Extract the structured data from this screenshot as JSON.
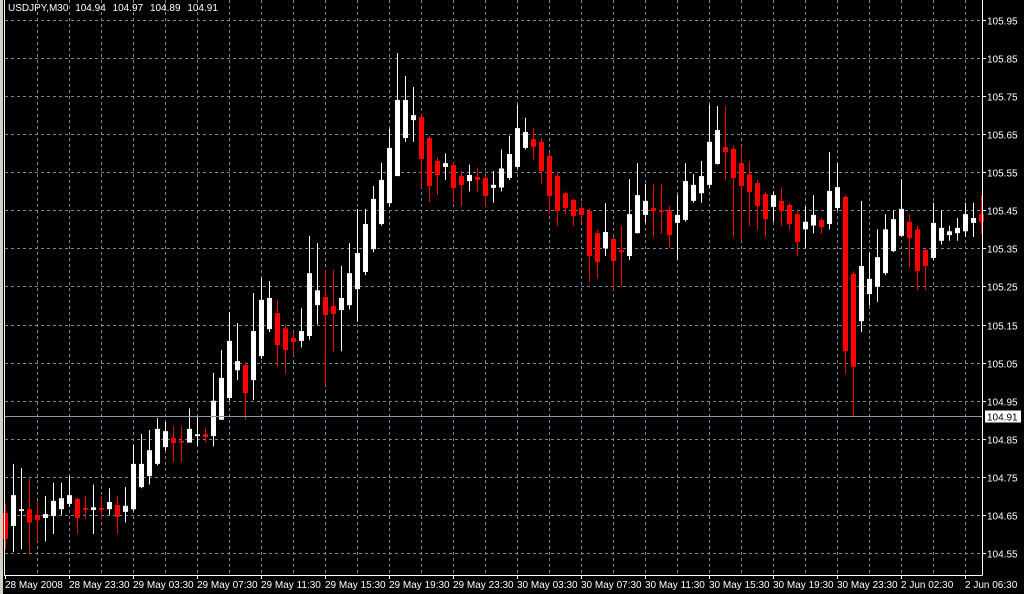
{
  "header": {
    "symbol": "USDJPY,M30",
    "open": "104.94",
    "high": "104.97",
    "low": "104.89",
    "close": "104.91"
  },
  "colors": {
    "background": "#000000",
    "bull": "#ffffff",
    "bear": "#ff0000",
    "grid": "#778899",
    "axis": "#ffffff",
    "price_line": "#8c9aa8"
  },
  "chart_data": {
    "type": "candlestick",
    "title": "USDJPY,M30",
    "ylim": [
      104.52,
      106.0
    ],
    "grid": true,
    "y_ticks": [
      "105.95",
      "105.85",
      "105.75",
      "105.65",
      "105.55",
      "105.45",
      "105.35",
      "105.25",
      "105.15",
      "105.05",
      "104.95",
      "104.85",
      "104.75",
      "104.65",
      "104.55"
    ],
    "x_ticks": [
      "28 May 2008",
      "28 May 23:30",
      "29 May 03:30",
      "29 May 07:30",
      "29 May 11:30",
      "29 May 15:30",
      "29 May 19:30",
      "29 May 23:30",
      "30 May 03:30",
      "30 May 07:30",
      "30 May 11:30",
      "30 May 15:30",
      "30 May 19:30",
      "30 May 23:30",
      "2 Jun 02:30",
      "2 Jun 06:30"
    ],
    "bars_per_x_tick": 8,
    "current_price": "104.91",
    "ohlc": [
      [
        104.655,
        104.68,
        104.56,
        104.587
      ],
      [
        104.621,
        104.784,
        104.553,
        104.702
      ],
      [
        104.66,
        104.773,
        104.56,
        104.665
      ],
      [
        104.665,
        104.745,
        104.55,
        104.63
      ],
      [
        104.65,
        104.684,
        104.58,
        104.637
      ],
      [
        104.642,
        104.7,
        104.58,
        104.652
      ],
      [
        104.647,
        104.734,
        104.6,
        104.687
      ],
      [
        104.665,
        104.734,
        104.65,
        104.694
      ],
      [
        104.679,
        104.752,
        104.671,
        104.702
      ],
      [
        104.692,
        104.695,
        104.6,
        104.642
      ],
      [
        104.668,
        104.7,
        104.64,
        104.663
      ],
      [
        104.663,
        104.73,
        104.6,
        104.67
      ],
      [
        104.668,
        104.7,
        104.64,
        104.663
      ],
      [
        104.665,
        104.72,
        104.65,
        104.684
      ],
      [
        104.676,
        104.7,
        104.6,
        104.645
      ],
      [
        104.658,
        104.723,
        104.63,
        104.674
      ],
      [
        104.665,
        104.834,
        104.66,
        104.784
      ],
      [
        104.723,
        104.863,
        104.72,
        104.784
      ],
      [
        104.752,
        104.873,
        104.73,
        104.82
      ],
      [
        104.784,
        104.904,
        104.78,
        104.876
      ],
      [
        104.828,
        104.894,
        104.82,
        104.87
      ],
      [
        104.852,
        104.883,
        104.79,
        104.839
      ],
      [
        104.845,
        104.883,
        104.79,
        104.84
      ],
      [
        104.84,
        104.93,
        104.84,
        104.876
      ],
      [
        104.857,
        104.907,
        104.83,
        104.862
      ],
      [
        104.862,
        104.88,
        104.84,
        104.855
      ],
      [
        104.857,
        105.023,
        104.83,
        104.95
      ],
      [
        104.9,
        105.083,
        104.9,
        105.01
      ],
      [
        104.957,
        105.183,
        104.95,
        105.107
      ],
      [
        105.03,
        105.154,
        105.004,
        105.054
      ],
      [
        105.044,
        105.05,
        104.9,
        104.97
      ],
      [
        105.004,
        105.233,
        104.952,
        105.133
      ],
      [
        105.067,
        105.272,
        105.06,
        105.215
      ],
      [
        105.138,
        105.264,
        105.13,
        105.22
      ],
      [
        105.18,
        105.215,
        105.04,
        105.096
      ],
      [
        105.14,
        105.15,
        105.02,
        105.083
      ],
      [
        105.115,
        105.13,
        105.07,
        105.104
      ],
      [
        105.107,
        105.193,
        105.09,
        105.133
      ],
      [
        105.12,
        105.383,
        105.11,
        105.285
      ],
      [
        105.201,
        105.364,
        105.15,
        105.24
      ],
      [
        105.222,
        105.293,
        104.99,
        105.175
      ],
      [
        105.199,
        105.293,
        105.08,
        105.178
      ],
      [
        105.188,
        105.304,
        105.08,
        105.22
      ],
      [
        105.201,
        105.364,
        105.19,
        105.285
      ],
      [
        105.243,
        105.454,
        105.157,
        105.338
      ],
      [
        105.288,
        105.454,
        105.28,
        105.414
      ],
      [
        105.348,
        105.514,
        105.34,
        105.48
      ],
      [
        105.414,
        105.575,
        105.41,
        105.53
      ],
      [
        105.469,
        105.664,
        105.46,
        105.614
      ],
      [
        105.54,
        105.863,
        105.54,
        105.74
      ],
      [
        105.64,
        105.803,
        105.63,
        105.74
      ],
      [
        105.687,
        105.774,
        105.63,
        105.7
      ],
      [
        105.695,
        105.7,
        105.51,
        105.585
      ],
      [
        105.64,
        105.645,
        105.472,
        105.514
      ],
      [
        105.58,
        105.59,
        105.49,
        105.543
      ],
      [
        105.564,
        105.6,
        105.53,
        105.574
      ],
      [
        105.569,
        105.575,
        105.47,
        105.509
      ],
      [
        105.54,
        105.553,
        105.46,
        105.517
      ],
      [
        105.527,
        105.57,
        105.5,
        105.543
      ],
      [
        105.538,
        105.56,
        105.5,
        105.53
      ],
      [
        105.535,
        105.54,
        105.46,
        105.488
      ],
      [
        105.509,
        105.553,
        105.47,
        105.517
      ],
      [
        105.51,
        105.61,
        105.5,
        105.56
      ],
      [
        105.535,
        105.646,
        105.53,
        105.598
      ],
      [
        105.564,
        105.727,
        105.56,
        105.666
      ],
      [
        105.614,
        105.693,
        105.61,
        105.656
      ],
      [
        105.637,
        105.667,
        105.584,
        105.617
      ],
      [
        105.63,
        105.64,
        105.52,
        105.553
      ],
      [
        105.593,
        105.6,
        105.44,
        105.488
      ],
      [
        105.54,
        105.55,
        105.41,
        105.448
      ],
      [
        105.495,
        105.5,
        105.44,
        105.456
      ],
      [
        105.477,
        105.48,
        105.41,
        105.435
      ],
      [
        105.456,
        105.47,
        105.42,
        105.438
      ],
      [
        105.448,
        105.455,
        105.262,
        105.33
      ],
      [
        105.39,
        105.4,
        105.27,
        105.314
      ],
      [
        105.35,
        105.469,
        105.33,
        105.393
      ],
      [
        105.375,
        105.38,
        105.24,
        105.317
      ],
      [
        105.346,
        105.41,
        105.25,
        105.34
      ],
      [
        105.33,
        105.532,
        105.32,
        105.44
      ],
      [
        105.39,
        105.574,
        105.39,
        105.49
      ],
      [
        105.438,
        105.52,
        105.417,
        105.475
      ],
      [
        105.456,
        105.52,
        105.38,
        105.448
      ],
      [
        105.45,
        105.52,
        105.39,
        105.447
      ],
      [
        105.45,
        105.46,
        105.35,
        105.385
      ],
      [
        105.417,
        105.49,
        105.32,
        105.438
      ],
      [
        105.425,
        105.574,
        105.42,
        105.527
      ],
      [
        105.475,
        105.545,
        105.47,
        105.517
      ],
      [
        105.495,
        105.58,
        105.47,
        105.54
      ],
      [
        105.517,
        105.727,
        105.51,
        105.63
      ],
      [
        105.572,
        105.724,
        105.57,
        105.661
      ],
      [
        105.616,
        105.724,
        105.53,
        105.603
      ],
      [
        105.611,
        105.62,
        105.38,
        105.535
      ],
      [
        105.574,
        105.62,
        105.37,
        105.514
      ],
      [
        105.545,
        105.58,
        105.41,
        105.498
      ],
      [
        105.522,
        105.53,
        105.4,
        105.461
      ],
      [
        105.493,
        105.5,
        105.38,
        105.427
      ],
      [
        105.459,
        105.5,
        105.42,
        105.49
      ],
      [
        105.475,
        105.51,
        105.41,
        105.448
      ],
      [
        105.464,
        105.47,
        105.4,
        105.414
      ],
      [
        105.44,
        105.45,
        105.33,
        105.367
      ],
      [
        105.4,
        105.46,
        105.35,
        105.42
      ],
      [
        105.41,
        105.49,
        105.39,
        105.438
      ],
      [
        105.425,
        105.43,
        105.39,
        105.406
      ],
      [
        105.414,
        105.603,
        105.4,
        105.501
      ],
      [
        105.456,
        105.574,
        105.45,
        105.511
      ],
      [
        105.485,
        105.49,
        105.02,
        105.08
      ],
      [
        105.283,
        105.29,
        104.91,
        105.039
      ],
      [
        105.159,
        105.475,
        105.13,
        105.304
      ],
      [
        105.23,
        105.34,
        105.2,
        105.27
      ],
      [
        105.249,
        105.4,
        105.21,
        105.327
      ],
      [
        105.285,
        105.44,
        105.28,
        105.4
      ],
      [
        105.343,
        105.45,
        105.34,
        105.427
      ],
      [
        105.383,
        105.532,
        105.38,
        105.454
      ],
      [
        105.42,
        105.44,
        105.3,
        105.377
      ],
      [
        105.4,
        105.41,
        105.24,
        105.29
      ],
      [
        105.346,
        105.35,
        105.24,
        105.304
      ],
      [
        105.325,
        105.47,
        105.32,
        105.417
      ],
      [
        105.37,
        105.45,
        105.36,
        105.404
      ],
      [
        105.385,
        105.41,
        105.37,
        105.395
      ],
      [
        105.39,
        105.43,
        105.37,
        105.404
      ],
      [
        105.395,
        105.47,
        105.38,
        105.44
      ],
      [
        105.417,
        105.47,
        105.38,
        105.43
      ],
      [
        105.44,
        105.49,
        105.39,
        105.42
      ]
    ]
  }
}
